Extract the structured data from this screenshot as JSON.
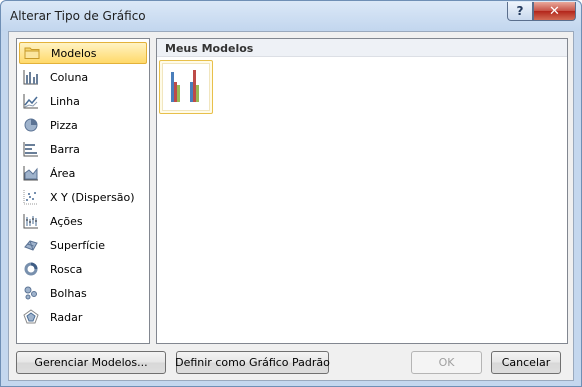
{
  "window": {
    "title": "Alterar Tipo de Gráfico",
    "help_label": "?",
    "close_label": "✕"
  },
  "categories": [
    {
      "label": "Modelos",
      "icon": "folder-icon",
      "selected": true
    },
    {
      "label": "Coluna",
      "icon": "column-chart-icon",
      "selected": false
    },
    {
      "label": "Linha",
      "icon": "line-chart-icon",
      "selected": false
    },
    {
      "label": "Pizza",
      "icon": "pie-chart-icon",
      "selected": false
    },
    {
      "label": "Barra",
      "icon": "bar-chart-icon",
      "selected": false
    },
    {
      "label": "Área",
      "icon": "area-chart-icon",
      "selected": false
    },
    {
      "label": "X Y (Dispersão)",
      "icon": "scatter-chart-icon",
      "selected": false
    },
    {
      "label": "Ações",
      "icon": "stock-chart-icon",
      "selected": false
    },
    {
      "label": "Superfície",
      "icon": "surface-chart-icon",
      "selected": false
    },
    {
      "label": "Rosca",
      "icon": "doughnut-chart-icon",
      "selected": false
    },
    {
      "label": "Bolhas",
      "icon": "bubble-chart-icon",
      "selected": false
    },
    {
      "label": "Radar",
      "icon": "radar-chart-icon",
      "selected": false
    }
  ],
  "templates": {
    "header": "Meus Modelos",
    "items": [
      {
        "icon": "clustered-column-template-icon",
        "colors": [
          "#4a7ebb",
          "#be4b48",
          "#98b954"
        ]
      }
    ]
  },
  "footer": {
    "manage_label": "Gerenciar Modelos...",
    "set_default_label": "Definir como Gráfico Padrão",
    "ok_label": "OK",
    "cancel_label": "Cancelar"
  }
}
